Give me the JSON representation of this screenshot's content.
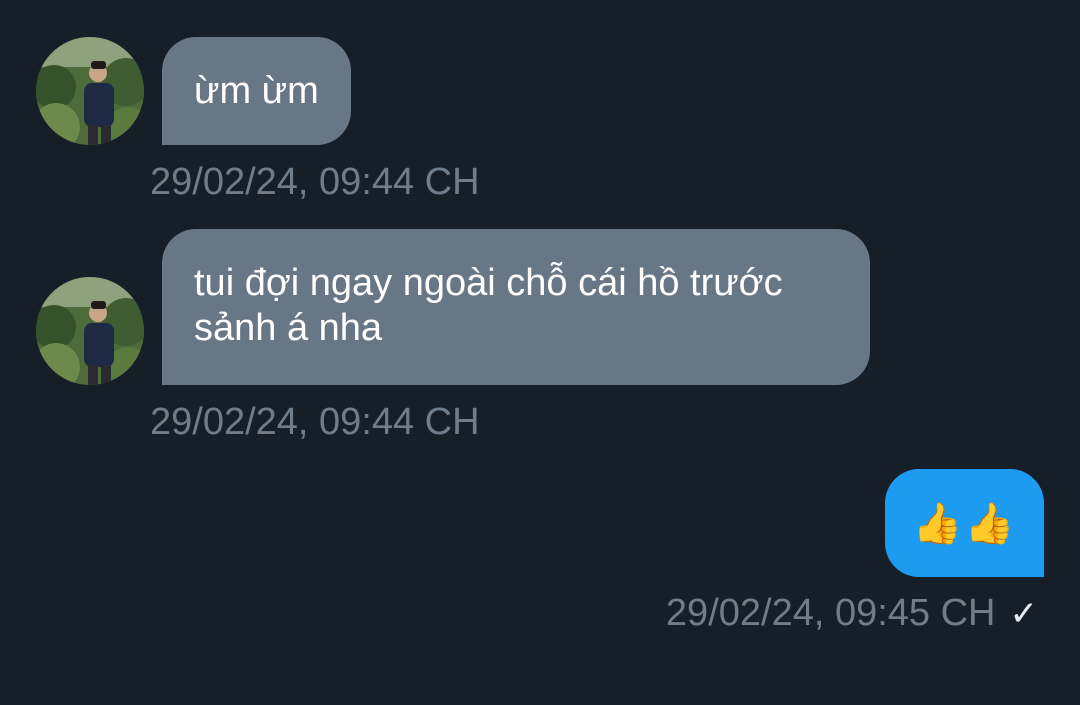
{
  "conversation": {
    "messages": [
      {
        "direction": "incoming",
        "text": "ừm ừm",
        "timestamp": "29/02/24, 09:44 CH"
      },
      {
        "direction": "incoming",
        "text": "tui đợi ngay ngoài chỗ cái hồ trước sảnh á nha",
        "timestamp": "29/02/24, 09:44 CH"
      },
      {
        "direction": "outgoing",
        "text": "👍👍",
        "timestamp": "29/02/24, 09:45 CH",
        "status_icon": "check-icon",
        "status_glyph": "✓"
      }
    ]
  },
  "colors": {
    "background": "#161e28",
    "incoming_bubble": "#677786",
    "outgoing_bubble": "#1d9bf0",
    "timestamp": "#6f7d8b"
  }
}
